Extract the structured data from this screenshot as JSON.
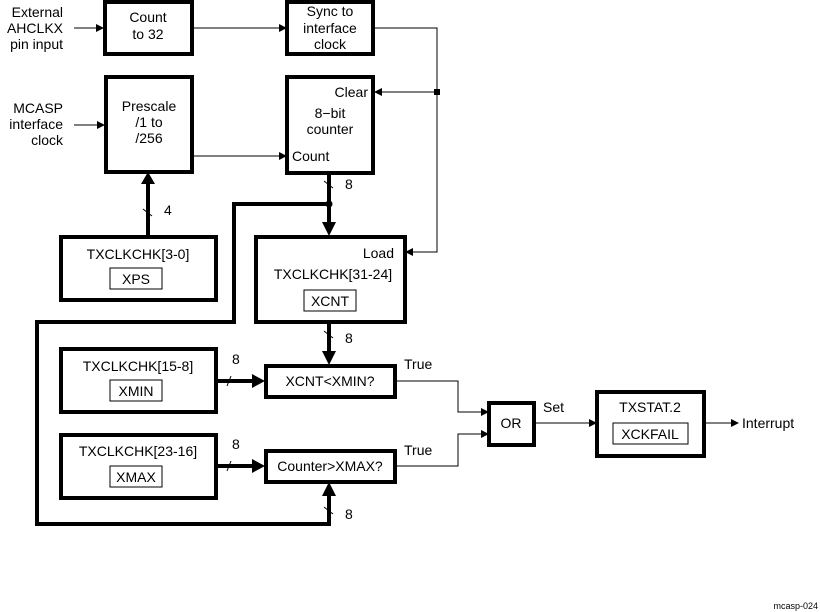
{
  "diagram": {
    "inputs": {
      "external": [
        "External",
        "AHCLKX",
        "pin input"
      ],
      "mcasp": [
        "MCASP",
        "interface",
        "clock"
      ]
    },
    "blocks": {
      "count32": [
        "Count",
        "to 32"
      ],
      "sync": [
        "Sync to",
        "interface",
        "clock"
      ],
      "prescale": [
        "Prescale",
        "/1 to",
        "/256"
      ],
      "counter": {
        "clear_port": "Clear",
        "lines": [
          "8−bit",
          "counter"
        ],
        "count_port": "Count"
      },
      "xps_reg": {
        "title": "TXCLKCHK[3-0]",
        "field": "XPS"
      },
      "xcnt_reg": {
        "load_port": "Load",
        "title": "TXCLKCHK[31-24]",
        "field": "XCNT"
      },
      "xmin_reg": {
        "title": "TXCLKCHK[15-8]",
        "field": "XMIN"
      },
      "xmax_reg": {
        "title": "TXCLKCHK[23-16]",
        "field": "XMAX"
      },
      "cmp_min": "XCNT<XMIN?",
      "cmp_max": "Counter>XMAX?",
      "or_gate": "OR",
      "status": {
        "title": "TXSTAT.2",
        "field": "XCKFAIL"
      }
    },
    "bus_widths": {
      "counter_out": "8",
      "xps": "4",
      "xcnt_out": "8",
      "xmin": "8",
      "xmax": "8",
      "counter_feedback": "8"
    },
    "signals": {
      "true_min": "True",
      "true_max": "True",
      "set": "Set",
      "interrupt": "Interrupt"
    },
    "figure_id": "mcasp-024"
  }
}
